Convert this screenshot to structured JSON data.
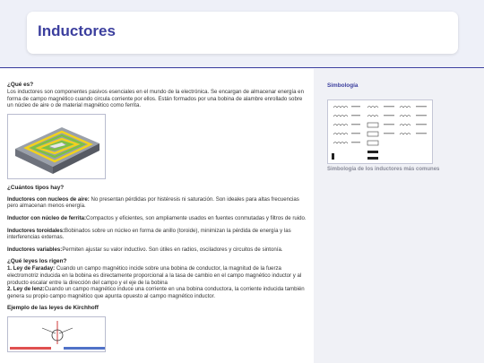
{
  "header": {
    "title": "Inductores"
  },
  "intro": {
    "heading": "¿Qué es?",
    "text": "Los inductores son componentes pasivos esenciales en el mundo de la electrónica. Se encargan de almacenar energía en forma de campo magnético cuando circula corriente por ellos. Están formados por una bobina de alambre enrollado sobre un núcleo de aire o de material magnético como ferrita."
  },
  "types": {
    "heading": "¿Cuántos tipos hay?",
    "items": [
      {
        "name": "Inductores con nucleos de aire:",
        "text": " No presentan pérdidas por histéresis ni saturación. Son ideales para altas frecuencias pero almacenan menos energía."
      },
      {
        "name": "Inductor con núcleo de ferrita:",
        "text": "Compactos y eficientes, son ampliamente usados en fuentes conmutadas y filtros de ruido."
      },
      {
        "name": "Inductores toroidales:",
        "text": "Bobinados sobre un núcleo en forma de anillo (toroide), minimizan la pérdida de energía y las interferencias externas."
      },
      {
        "name": "Inductores variables:",
        "text": "Permiten ajustar su valor inductivo. Son útiles en radios, osciladores y circuitos de sintonía."
      }
    ]
  },
  "laws": {
    "heading": "¿Qué leyes los rigen?",
    "items": [
      {
        "name": "1. Ley de Faraday:",
        "text": " Cuando un campo magnético incide sobre una bobina de conductor, la magnitud de la fuerza electromotriz inducida en la bobina es directamente proporcional a la tasa de cambio en el campo magnético inductor y al producto escalar entre la dirección del campo y el eje de la bobina"
      },
      {
        "name": "2. Ley de lenz:",
        "text": "Cuando un campo magnético induce una corriente en una bobina conductora, la corriente inducida también genera su propio campo magnético que apunta opuesto al campo magnético inductor."
      }
    ]
  },
  "kirchhoff": {
    "heading": "Ejemplo de las leyes de Kirchhoff"
  },
  "sidebar": {
    "title": "Simbología",
    "caption": "Simbología de los inductores más comunes"
  },
  "colors": {
    "accent": "#3c3f9e",
    "coil_yellow": "#f2d21b",
    "coil_green": "#7cc242",
    "core": "#7a7d88"
  }
}
